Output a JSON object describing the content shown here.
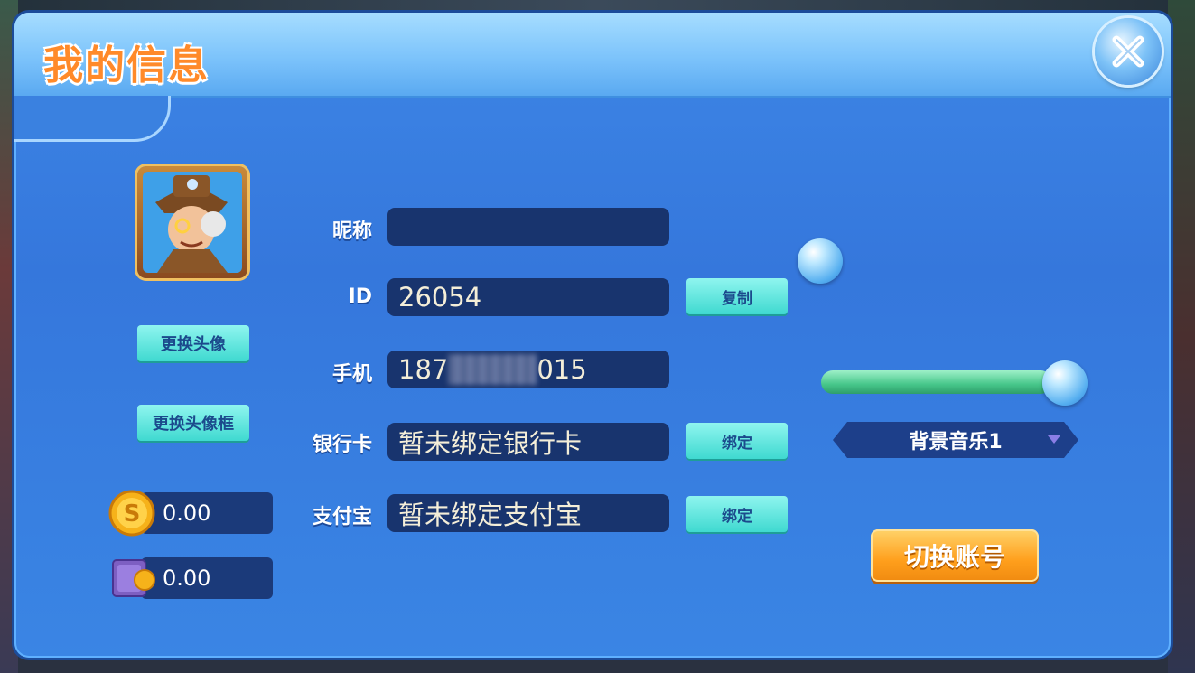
{
  "title": "我的信息",
  "avatar_buttons": {
    "change_avatar": "更换头像",
    "change_frame": "更换头像框"
  },
  "balances": [
    {
      "icon": "gold-coin-icon",
      "value": "0.00"
    },
    {
      "icon": "safe-box-icon",
      "value": "0.00"
    }
  ],
  "fields": {
    "nickname": {
      "label": "昵称",
      "value": ""
    },
    "id": {
      "label": "ID",
      "value": "26054",
      "button": "复制"
    },
    "phone": {
      "label": "手机",
      "prefix": "187",
      "suffix": "015"
    },
    "bank_card": {
      "label": "银行卡",
      "value": "暂未绑定银行卡",
      "button": "绑定"
    },
    "alipay": {
      "label": "支付宝",
      "value": "暂未绑定支付宝",
      "button": "绑定"
    }
  },
  "settings": {
    "music_volume_fraction": 1.0,
    "background_music": "背景音乐1"
  },
  "switch_account": "切换账号",
  "colors": {
    "panel": "#3a85e4",
    "header": "#7cc3fb",
    "title": "#ff8a2a",
    "field_bg": "#18346e",
    "cyan_button": "#3fd9d0",
    "orange_button": "#ff9f1c",
    "slider": "#46c68a"
  }
}
